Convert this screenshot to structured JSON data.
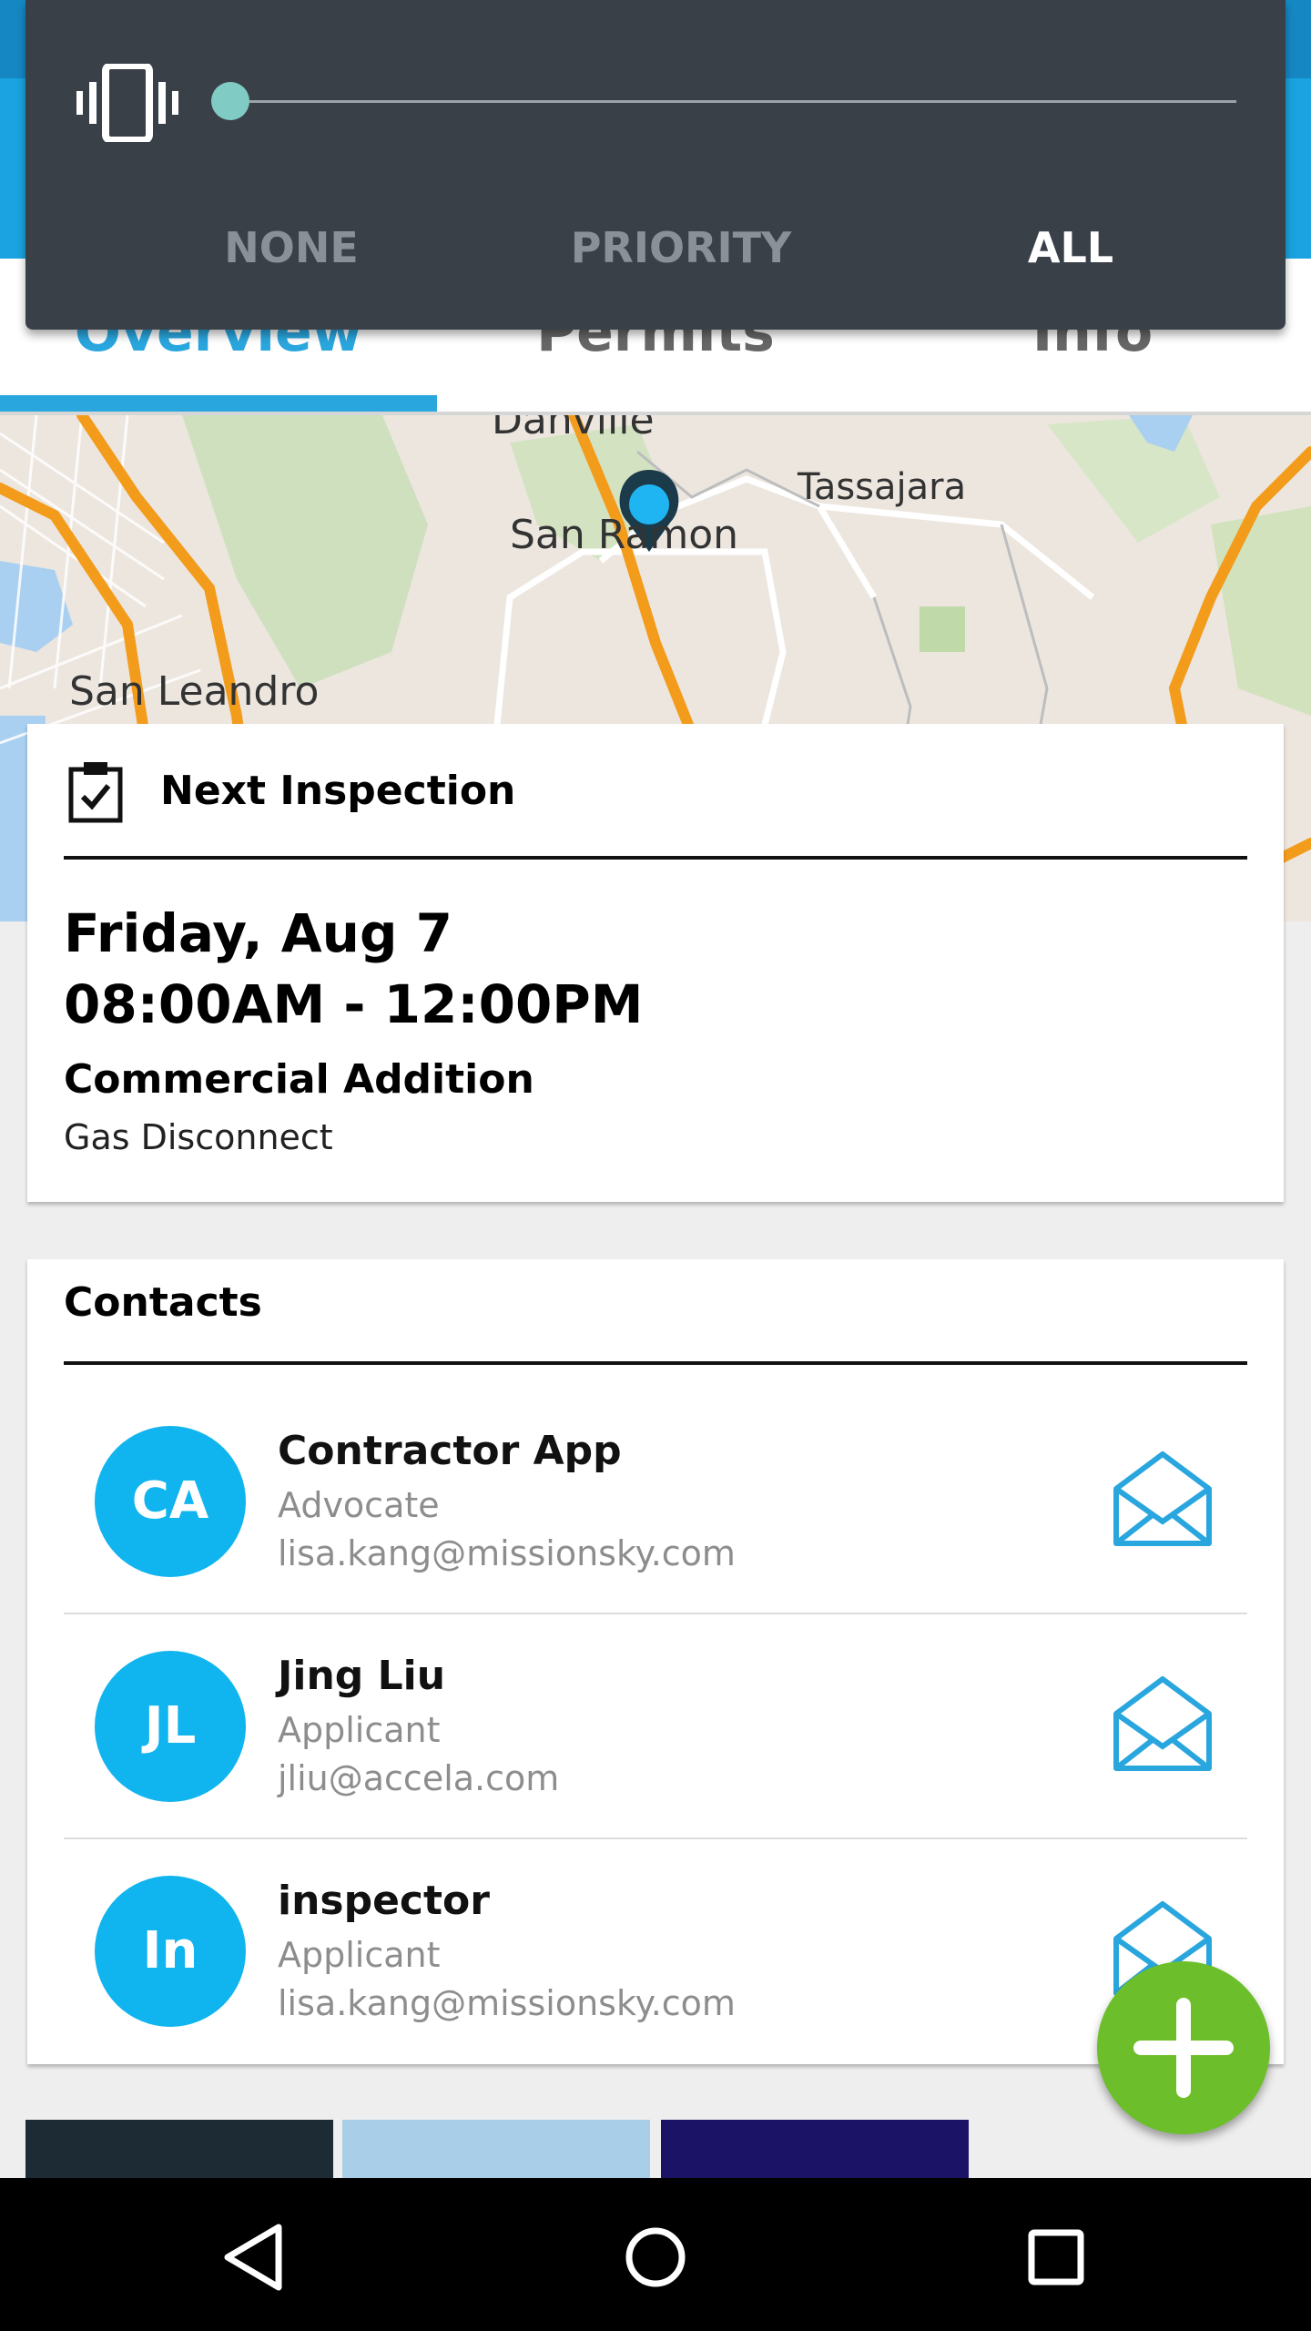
{
  "volume_panel": {
    "modes": [
      "NONE",
      "PRIORITY",
      "ALL"
    ],
    "selected_mode": "ALL",
    "slider_level": 0
  },
  "tabs": [
    "Overview",
    "Permits",
    "Info"
  ],
  "active_tab": "Overview",
  "map": {
    "labels": [
      "Danville",
      "San Ramon",
      "Tassajara",
      "San Leandro"
    ]
  },
  "inspection": {
    "header": "Next Inspection",
    "date": "Friday, Aug 7",
    "time": "08:00AM - 12:00PM",
    "type": "Commercial Addition",
    "subtype": "Gas Disconnect"
  },
  "contacts": {
    "header": "Contacts",
    "items": [
      {
        "initials": "CA",
        "name": "Contractor App",
        "role": "Advocate",
        "email": "lisa.kang@missionsky.com"
      },
      {
        "initials": "JL",
        "name": "Jing Liu",
        "role": "Applicant",
        "email": "jliu@accela.com"
      },
      {
        "initials": "In",
        "name": "inspector",
        "role": "Applicant",
        "email": "lisa.kang@missionsky.com"
      }
    ]
  },
  "colors": {
    "accent": "#2aa6de",
    "avatar": "#10b4ee",
    "fab": "#6cbf2a",
    "volume_panel": "#394047"
  },
  "icons": [
    "vibrate-icon",
    "clipboard-check-icon",
    "mail-icon",
    "plus-icon",
    "back-icon",
    "home-icon",
    "recents-icon",
    "map-pin-icon"
  ]
}
